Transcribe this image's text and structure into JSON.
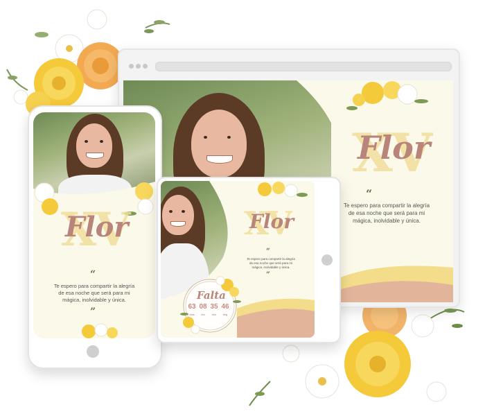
{
  "invitation": {
    "name": "Flor",
    "monogram": "XV",
    "quote_open": "“",
    "quote_close": "”",
    "message_lines": [
      "Te espero para compartir la alegría",
      "de esa noche que será para mi",
      "mágica, inolvidable y única."
    ]
  },
  "countdown": {
    "title": "Falta",
    "values": [
      "63",
      "08",
      "35",
      "46"
    ],
    "units": [
      "días",
      "hrs",
      "min",
      "seg"
    ]
  },
  "colors": {
    "name": "#b98479",
    "monogram": "#f1df9c",
    "background": "#fbf9e9",
    "wave_yellow": "#f3dc8a",
    "wave_rose": "#e2b59a"
  },
  "icons": [
    "browser-dot-icon",
    "flower-icon",
    "home-button-icon",
    "quote-icon"
  ]
}
